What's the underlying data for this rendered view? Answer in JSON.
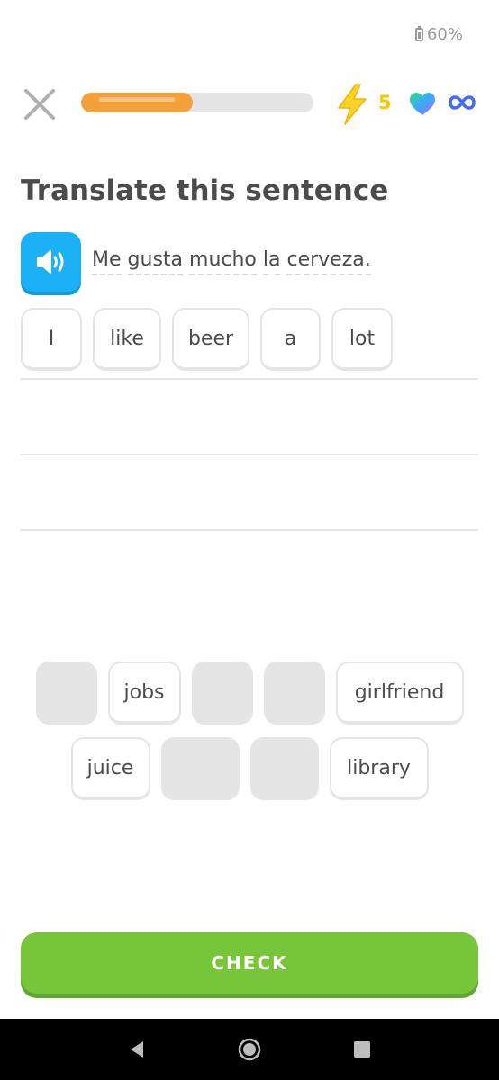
{
  "status": {
    "battery": "60%"
  },
  "header": {
    "streak_count": "5",
    "progress_value": 0.48,
    "icons": [
      "close-icon",
      "lightning-icon",
      "heart-icon",
      "infinity-icon"
    ]
  },
  "title": "Translate this sentence",
  "prompt": {
    "words": [
      "Me",
      "gusta",
      "mucho",
      "la",
      "cerveza."
    ]
  },
  "answer": [
    "I",
    "like",
    "beer",
    "a",
    "lot"
  ],
  "word_bank": {
    "row1": [
      "",
      "jobs",
      "",
      "",
      "girlfriend"
    ],
    "row2": [
      "juice",
      "",
      "",
      "library"
    ]
  },
  "check_label": "CHECK",
  "colors": {
    "accent_green": "#77c63a",
    "accent_blue": "#1cb0f6",
    "progress": "#f5a13a",
    "streak": "#f7c800"
  }
}
